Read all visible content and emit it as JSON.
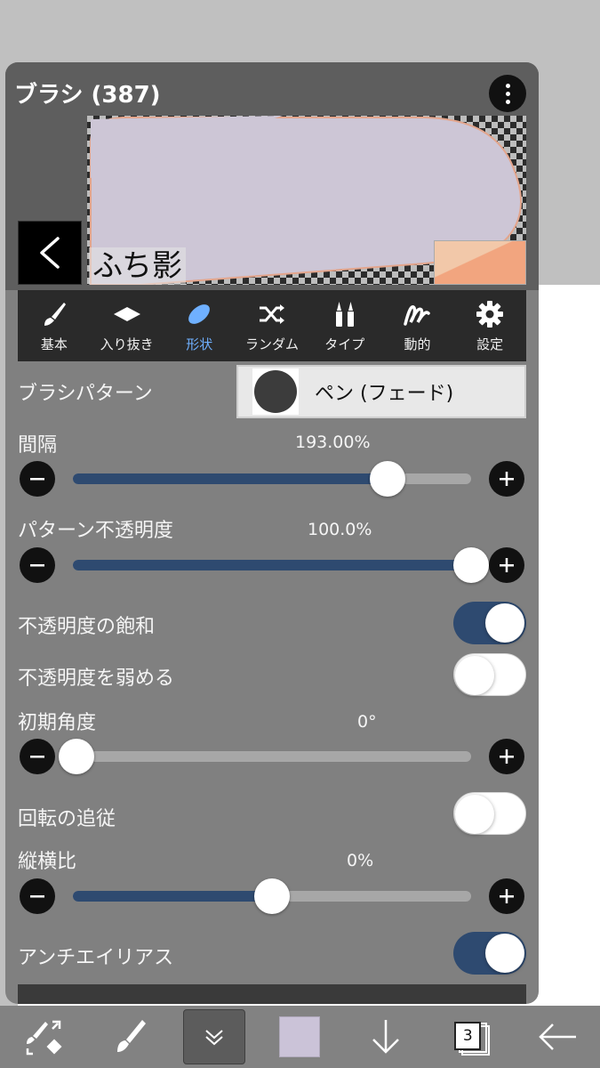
{
  "panel": {
    "title": "ブラシ (387)",
    "brush_name": "ふち影"
  },
  "tabs": [
    {
      "label": "基本",
      "icon": "brush-icon",
      "active": false
    },
    {
      "label": "入り抜き",
      "icon": "diamond-icon",
      "active": false
    },
    {
      "label": "形状",
      "icon": "ellipse-icon",
      "active": true
    },
    {
      "label": "ランダム",
      "icon": "shuffle-icon",
      "active": false
    },
    {
      "label": "タイプ",
      "icon": "brush-type-icon",
      "active": false
    },
    {
      "label": "動的",
      "icon": "dynamic-stroke-icon",
      "active": false
    },
    {
      "label": "設定",
      "icon": "gear-icon",
      "active": false
    }
  ],
  "pattern": {
    "label": "ブラシパターン",
    "value": "ペン (フェード)"
  },
  "sliders": {
    "interval": {
      "label": "間隔",
      "value_text": "193.00%",
      "fraction": 0.79
    },
    "pattern_opacity": {
      "label": "パターン不透明度",
      "value_text": "100.0%",
      "fraction": 1.0
    },
    "initial_angle": {
      "label": "初期角度",
      "value_text": "0°",
      "fraction": 0.0
    },
    "aspect_ratio": {
      "label": "縦横比",
      "value_text": "0%",
      "fraction": 0.5
    }
  },
  "toggles": {
    "opacity_saturation": {
      "label": "不透明度の飽和",
      "on": true
    },
    "weaken_opacity": {
      "label": "不透明度を弱める",
      "on": false
    },
    "follow_rotation": {
      "label": "回転の追従",
      "on": false
    },
    "antialias": {
      "label": "アンチエイリアス",
      "on": true
    }
  },
  "toolbar": {
    "layer_count": "3"
  },
  "colors": {
    "accent": "#2e4a70",
    "active_tab": "#6fb0ff",
    "current_color": "#cbc3d8",
    "swatch_color": "#f2a57f"
  }
}
